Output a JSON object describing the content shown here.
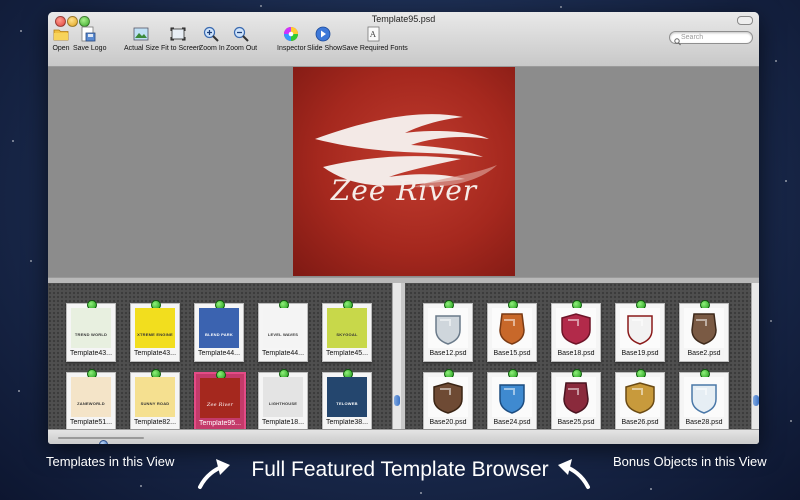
{
  "window": {
    "title": "Template95.psd"
  },
  "toolbar": {
    "items": [
      {
        "label": "Open",
        "icon": "folder-icon"
      },
      {
        "label": "Save Logo",
        "icon": "save-logo-icon"
      },
      {
        "label": "Actual Size",
        "icon": "image-icon"
      },
      {
        "label": "Fit to Screen",
        "icon": "fit-screen-icon"
      },
      {
        "label": "Zoom In",
        "icon": "zoom-in-icon"
      },
      {
        "label": "Zoom Out",
        "icon": "zoom-out-icon"
      },
      {
        "label": "Inspector",
        "icon": "color-wheel-icon"
      },
      {
        "label": "Slide Show",
        "icon": "play-icon"
      },
      {
        "label": "Save Required Fonts",
        "icon": "fonts-icon"
      }
    ]
  },
  "search": {
    "placeholder": "Search"
  },
  "preview": {
    "brand": "Zee River",
    "bg": "#a5281e"
  },
  "templates": [
    {
      "name": "Template43...",
      "logo": "TREND WORLD",
      "bg": "#e8f0e0"
    },
    {
      "name": "Template43...",
      "logo": "XTREME ENGINE",
      "bg": "#f2de1e"
    },
    {
      "name": "Template44...",
      "logo": "BLEND PARK",
      "bg": "#3b63b0"
    },
    {
      "name": "Template44...",
      "logo": "LEVEL WAVES",
      "bg": "#f4f4f4"
    },
    {
      "name": "Template45...",
      "logo": "SKYGOAL",
      "bg": "#c8d84a"
    },
    {
      "name": "Template51...",
      "logo": "ZANEWORLD",
      "bg": "#f4e4c8"
    },
    {
      "name": "Template82...",
      "logo": "SUNNY ROAD",
      "bg": "#f5e090"
    },
    {
      "name": "Template95...",
      "logo": "Zee River",
      "bg": "#a5281e",
      "selected": true
    },
    {
      "name": "Template18...",
      "logo": "LIGHTHOUSE",
      "bg": "#e4e4e4"
    },
    {
      "name": "Template38...",
      "logo": "TELOWEB",
      "bg": "#24466e"
    }
  ],
  "bonus": [
    {
      "name": "Base12.psd",
      "fill": "#cfd6dc",
      "stroke": "#6a7a8a"
    },
    {
      "name": "Base15.psd",
      "fill": "#c8682a",
      "stroke": "#7a3a14"
    },
    {
      "name": "Base18.psd",
      "fill": "#b22a4a",
      "stroke": "#6e1428"
    },
    {
      "name": "Base19.psd",
      "fill": "#f2f2f2",
      "stroke": "#8a1a1a"
    },
    {
      "name": "Base2.psd",
      "fill": "#7a5a44",
      "stroke": "#3e2a1c"
    },
    {
      "name": "Base20.psd",
      "fill": "#6e4a34",
      "stroke": "#3a2414"
    },
    {
      "name": "Base24.psd",
      "fill": "#3f8ad0",
      "stroke": "#1c4c80"
    },
    {
      "name": "Base25.psd",
      "fill": "#8a2a3c",
      "stroke": "#4a1420"
    },
    {
      "name": "Base26.psd",
      "fill": "#c89a3c",
      "stroke": "#6a4a14"
    },
    {
      "name": "Base28.psd",
      "fill": "#e6eef4",
      "stroke": "#4a78a8"
    }
  ],
  "captions": {
    "left": "Templates in this View",
    "center": "Full Featured  Template Browser",
    "right": "Bonus Objects in this View"
  },
  "zoom_slider": {
    "value_fraction": 0.52
  }
}
